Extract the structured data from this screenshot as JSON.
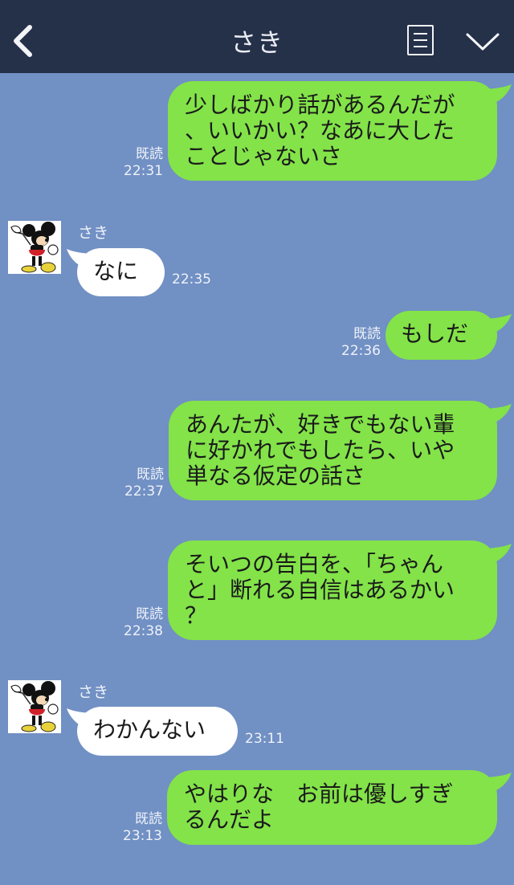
{
  "header": {
    "title": "さき"
  },
  "contact": {
    "name": "さき"
  },
  "messages": [
    {
      "dir": "out",
      "text": "少しばかり話があるんだが\n、いいかい？なあに大した\nことじゃないさ",
      "read": "既読",
      "time": "22:31"
    },
    {
      "dir": "in",
      "text": "なに",
      "time": "22:35"
    },
    {
      "dir": "out",
      "text": "もしだ",
      "read": "既読",
      "time": "22:36"
    },
    {
      "dir": "out",
      "text": "あんたが、好きでもない輩\nに好かれでもしたら、いや\n単なる仮定の話さ",
      "read": "既読",
      "time": "22:37"
    },
    {
      "dir": "out",
      "text": "そいつの告白を、「ちゃん\nと」断れる自信はあるかい\n？",
      "read": "既読",
      "time": "22:38"
    },
    {
      "dir": "in",
      "text": "わかんない",
      "time": "23:11"
    },
    {
      "dir": "out",
      "text": "やはりな　お前は優しすぎ\nるんだよ",
      "read": "既読",
      "time": "23:13"
    }
  ],
  "colors": {
    "header_bg": "#253049",
    "chat_bg": "#7190c4",
    "outgoing_bubble": "#83e349",
    "incoming_bubble": "#ffffff"
  },
  "icons": {
    "back": "chevron-left-icon",
    "menu": "document-list-icon",
    "expand": "chevron-down-icon",
    "avatar": "cartoon-mouse-avatar"
  }
}
